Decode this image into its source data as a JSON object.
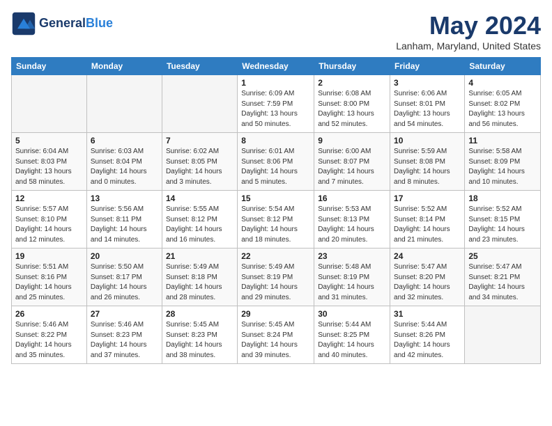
{
  "header": {
    "logo_line1": "General",
    "logo_line2": "Blue",
    "month": "May 2024",
    "location": "Lanham, Maryland, United States"
  },
  "days_of_week": [
    "Sunday",
    "Monday",
    "Tuesday",
    "Wednesday",
    "Thursday",
    "Friday",
    "Saturday"
  ],
  "weeks": [
    [
      {
        "day": "",
        "info": ""
      },
      {
        "day": "",
        "info": ""
      },
      {
        "day": "",
        "info": ""
      },
      {
        "day": "1",
        "info": "Sunrise: 6:09 AM\nSunset: 7:59 PM\nDaylight: 13 hours\nand 50 minutes."
      },
      {
        "day": "2",
        "info": "Sunrise: 6:08 AM\nSunset: 8:00 PM\nDaylight: 13 hours\nand 52 minutes."
      },
      {
        "day": "3",
        "info": "Sunrise: 6:06 AM\nSunset: 8:01 PM\nDaylight: 13 hours\nand 54 minutes."
      },
      {
        "day": "4",
        "info": "Sunrise: 6:05 AM\nSunset: 8:02 PM\nDaylight: 13 hours\nand 56 minutes."
      }
    ],
    [
      {
        "day": "5",
        "info": "Sunrise: 6:04 AM\nSunset: 8:03 PM\nDaylight: 13 hours\nand 58 minutes."
      },
      {
        "day": "6",
        "info": "Sunrise: 6:03 AM\nSunset: 8:04 PM\nDaylight: 14 hours\nand 0 minutes."
      },
      {
        "day": "7",
        "info": "Sunrise: 6:02 AM\nSunset: 8:05 PM\nDaylight: 14 hours\nand 3 minutes."
      },
      {
        "day": "8",
        "info": "Sunrise: 6:01 AM\nSunset: 8:06 PM\nDaylight: 14 hours\nand 5 minutes."
      },
      {
        "day": "9",
        "info": "Sunrise: 6:00 AM\nSunset: 8:07 PM\nDaylight: 14 hours\nand 7 minutes."
      },
      {
        "day": "10",
        "info": "Sunrise: 5:59 AM\nSunset: 8:08 PM\nDaylight: 14 hours\nand 8 minutes."
      },
      {
        "day": "11",
        "info": "Sunrise: 5:58 AM\nSunset: 8:09 PM\nDaylight: 14 hours\nand 10 minutes."
      }
    ],
    [
      {
        "day": "12",
        "info": "Sunrise: 5:57 AM\nSunset: 8:10 PM\nDaylight: 14 hours\nand 12 minutes."
      },
      {
        "day": "13",
        "info": "Sunrise: 5:56 AM\nSunset: 8:11 PM\nDaylight: 14 hours\nand 14 minutes."
      },
      {
        "day": "14",
        "info": "Sunrise: 5:55 AM\nSunset: 8:12 PM\nDaylight: 14 hours\nand 16 minutes."
      },
      {
        "day": "15",
        "info": "Sunrise: 5:54 AM\nSunset: 8:12 PM\nDaylight: 14 hours\nand 18 minutes."
      },
      {
        "day": "16",
        "info": "Sunrise: 5:53 AM\nSunset: 8:13 PM\nDaylight: 14 hours\nand 20 minutes."
      },
      {
        "day": "17",
        "info": "Sunrise: 5:52 AM\nSunset: 8:14 PM\nDaylight: 14 hours\nand 21 minutes."
      },
      {
        "day": "18",
        "info": "Sunrise: 5:52 AM\nSunset: 8:15 PM\nDaylight: 14 hours\nand 23 minutes."
      }
    ],
    [
      {
        "day": "19",
        "info": "Sunrise: 5:51 AM\nSunset: 8:16 PM\nDaylight: 14 hours\nand 25 minutes."
      },
      {
        "day": "20",
        "info": "Sunrise: 5:50 AM\nSunset: 8:17 PM\nDaylight: 14 hours\nand 26 minutes."
      },
      {
        "day": "21",
        "info": "Sunrise: 5:49 AM\nSunset: 8:18 PM\nDaylight: 14 hours\nand 28 minutes."
      },
      {
        "day": "22",
        "info": "Sunrise: 5:49 AM\nSunset: 8:19 PM\nDaylight: 14 hours\nand 29 minutes."
      },
      {
        "day": "23",
        "info": "Sunrise: 5:48 AM\nSunset: 8:19 PM\nDaylight: 14 hours\nand 31 minutes."
      },
      {
        "day": "24",
        "info": "Sunrise: 5:47 AM\nSunset: 8:20 PM\nDaylight: 14 hours\nand 32 minutes."
      },
      {
        "day": "25",
        "info": "Sunrise: 5:47 AM\nSunset: 8:21 PM\nDaylight: 14 hours\nand 34 minutes."
      }
    ],
    [
      {
        "day": "26",
        "info": "Sunrise: 5:46 AM\nSunset: 8:22 PM\nDaylight: 14 hours\nand 35 minutes."
      },
      {
        "day": "27",
        "info": "Sunrise: 5:46 AM\nSunset: 8:23 PM\nDaylight: 14 hours\nand 37 minutes."
      },
      {
        "day": "28",
        "info": "Sunrise: 5:45 AM\nSunset: 8:23 PM\nDaylight: 14 hours\nand 38 minutes."
      },
      {
        "day": "29",
        "info": "Sunrise: 5:45 AM\nSunset: 8:24 PM\nDaylight: 14 hours\nand 39 minutes."
      },
      {
        "day": "30",
        "info": "Sunrise: 5:44 AM\nSunset: 8:25 PM\nDaylight: 14 hours\nand 40 minutes."
      },
      {
        "day": "31",
        "info": "Sunrise: 5:44 AM\nSunset: 8:26 PM\nDaylight: 14 hours\nand 42 minutes."
      },
      {
        "day": "",
        "info": ""
      }
    ]
  ]
}
